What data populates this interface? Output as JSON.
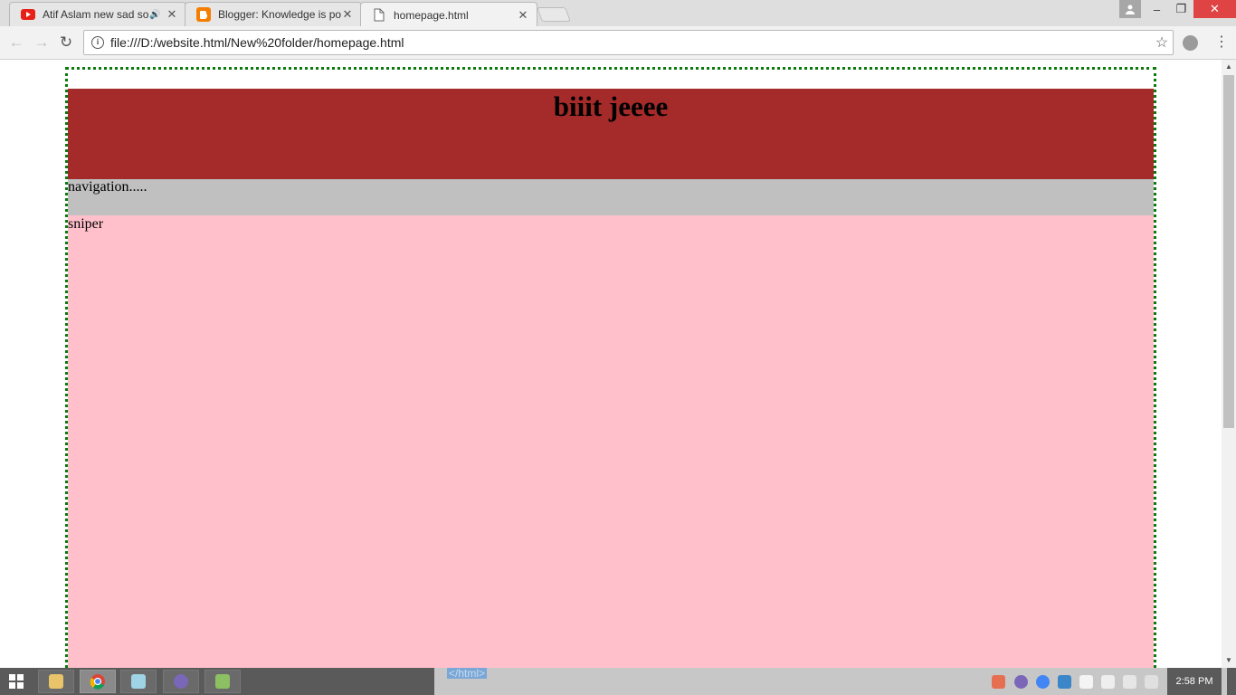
{
  "browser": {
    "tabs": [
      {
        "title": "Atif Aslam new sad so",
        "icon": "youtube-icon",
        "icon_color": "#e62117",
        "audio": true
      },
      {
        "title": "Blogger: Knowledge is po",
        "icon": "blogger-icon",
        "icon_color": "#f57d00",
        "audio": false
      },
      {
        "title": "homepage.html",
        "icon": "document-icon",
        "icon_color": "#888888",
        "audio": false
      }
    ],
    "url": "file:///D:/website.html/New%20folder/homepage.html"
  },
  "page": {
    "heading": "biiit jeeee",
    "navigation_text": "navigation.....",
    "content_text": "sniper",
    "colors": {
      "header_bg": "#a52a2a",
      "nav_bg": "#c0c0c0",
      "content_bg": "#ffc0cb",
      "wrapper_border": "#0a7a0a"
    }
  },
  "taskbar": {
    "snippet_text": "</html>",
    "clock": "2:58 PM"
  }
}
